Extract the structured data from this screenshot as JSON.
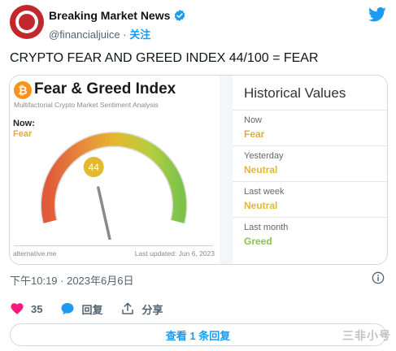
{
  "header": {
    "display_name": "Breaking Market News",
    "handle": "@financialjuice",
    "separator": "·",
    "follow_label": "关注"
  },
  "tweet": {
    "text": "CRYPTO FEAR AND GREED INDEX 44/100 = FEAR"
  },
  "fear_greed_card": {
    "badge": "₿",
    "title": "Fear & Greed Index",
    "subtitle": "Multifactorial Crypto Market Sentiment Analysis",
    "now_label": "Now:",
    "now_value": "Fear",
    "index_value": "44",
    "gauge_min": 0,
    "gauge_max": 100,
    "source": "alternative.me",
    "last_updated": "Last updated: Jun 6, 2023",
    "colors": {
      "fear": "#e3a93a",
      "neutral": "#e3b92f",
      "greed": "#8bc34a",
      "extreme_fear": "#e05a3a"
    }
  },
  "historical": {
    "title": "Historical Values",
    "rows": [
      {
        "label": "Now",
        "value": "Fear",
        "color": "#e3a93a"
      },
      {
        "label": "Yesterday",
        "value": "Neutral",
        "color": "#e3b92f"
      },
      {
        "label": "Last week",
        "value": "Neutral",
        "color": "#e3b92f"
      },
      {
        "label": "Last month",
        "value": "Greed",
        "color": "#8bc34a"
      }
    ]
  },
  "meta": {
    "timestamp": "下午10:19 · 2023年6月6日"
  },
  "actions": {
    "like_count": "35",
    "reply_label": "回复",
    "share_label": "分享"
  },
  "footer": {
    "view_replies_label": "查看 1 条回复",
    "watermark": "三非小号"
  },
  "icons": {
    "verified": "verified-badge-icon",
    "twitter": "twitter-bird-icon",
    "info": "info-icon",
    "like": "heart-icon",
    "reply": "speech-bubble-icon",
    "share": "share-upload-icon"
  },
  "brand_colors": {
    "twitter_blue": "#1d9bf0",
    "like_pink": "#f91880",
    "avatar_red": "#c1272d"
  }
}
